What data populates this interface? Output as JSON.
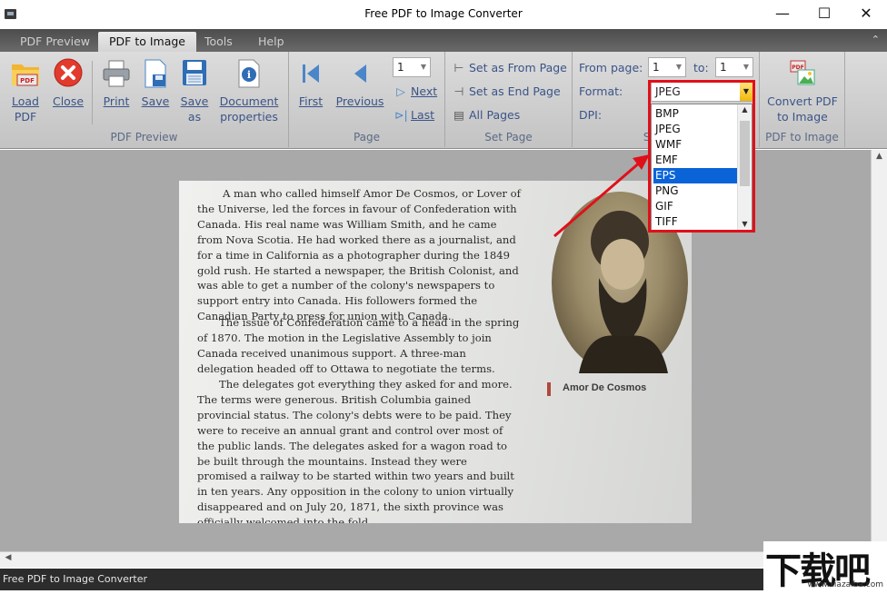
{
  "window": {
    "title": "Free PDF to Image Converter",
    "controls": {
      "minimize": "—",
      "maximize": "☐",
      "close": "✕"
    }
  },
  "tabs": [
    {
      "label": "PDF Preview"
    },
    {
      "label": "PDF to Image",
      "active": true
    },
    {
      "label": "Tools"
    },
    {
      "label": "Help"
    }
  ],
  "ribbon": {
    "groups": {
      "pdf_preview": "PDF Preview",
      "page": "Page",
      "set_page": "Set Page",
      "settings": "Settings",
      "pdf_to_image": "PDF to Image"
    },
    "load_pdf": {
      "line1": "Load",
      "line2": "PDF"
    },
    "close": "Close",
    "print": "Print",
    "save": "Save",
    "save_as": {
      "line1": "Save",
      "line2": "as"
    },
    "document_properties": {
      "line1": "Document",
      "line2": "properties"
    },
    "first": "First",
    "previous": "Previous",
    "page_number": "1",
    "next": "Next",
    "last": "Last",
    "set_as_from_page": "Set as From Page",
    "set_as_end_page": "Set as End Page",
    "all_pages": "All Pages",
    "from_page_label": "From page:",
    "from_page_value": "1",
    "to_label": "to:",
    "to_value": "1",
    "format_label": "Format:",
    "format_value": "JPEG",
    "dpi_label": "DPI:",
    "convert": {
      "line1": "Convert PDF",
      "line2": "to Image"
    }
  },
  "format_dropdown": {
    "options": [
      "BMP",
      "JPEG",
      "WMF",
      "EMF",
      "EPS",
      "PNG",
      "GIF",
      "TIFF"
    ],
    "selected": "EPS"
  },
  "document": {
    "paragraph1": "A man who called himself Amor De Cosmos, or Lover of the Universe, led the forces in favour of Confederation with Canada. His real name was William Smith, and he came from Nova Scotia. He had worked there as a journalist, and for a time in California as a photographer during the 1849 gold rush. He started a newspaper, the British Colonist, and was able to get a number of the colony's newspapers to support entry into Canada. His followers formed the Canadian Party to press for union with Canada.",
    "paragraph2": "The issue of Confederation came to a head in the spring of 1870. The motion in the Legislative Assembly to join Canada received unanimous support. A three-man delegation headed off to Ottawa to negotiate the terms.",
    "paragraph3": "The delegates got everything they asked for and more. The terms were generous. British Columbia gained provincial status. The colony's debts were to be paid. They were to receive an annual grant and control over most of the public lands. The delegates asked for a wagon road to be built through the mountains. Instead they were promised a railway to be started within two years and built in ten years. Any opposition in the colony to union virtually disappeared and on July 20, 1871, the sixth province was officially welcomed into the fold.",
    "portrait_caption": "Amor De Cosmos"
  },
  "status": {
    "text": "Free PDF to Image Converter"
  },
  "watermark": {
    "big": "下载吧",
    "small": "www.xiazaiba.com"
  },
  "colors": {
    "accent": "#3a5488",
    "highlight": "#e0101a",
    "selection": "#0a64d8"
  }
}
